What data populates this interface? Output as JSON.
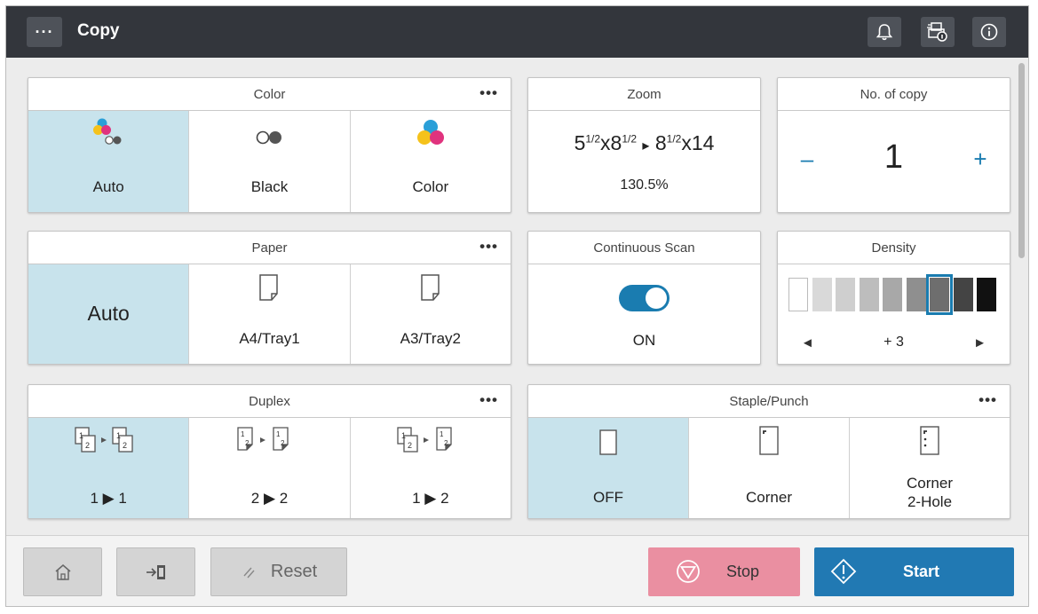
{
  "header": {
    "menu_label": "···",
    "title": "Copy",
    "icons": [
      "bell-icon",
      "job-status-icon",
      "info-icon"
    ]
  },
  "more_label": "•••",
  "color_panel": {
    "title": "Color",
    "options": [
      "Auto",
      "Black",
      "Color"
    ],
    "selected": "Auto"
  },
  "zoom_panel": {
    "title": "Zoom",
    "ratio_from_whole": "5",
    "ratio_from_frac": "1/2",
    "ratio_mid": "x8",
    "ratio_mid_frac": "1/2",
    "ratio_arrow": "▸",
    "ratio_to_whole": "8",
    "ratio_to_frac": "1/2",
    "ratio_to_rest": "x14",
    "percent": "130.5%"
  },
  "copies_panel": {
    "title": "No. of copy",
    "minus": "–",
    "value": "1",
    "plus": "+"
  },
  "paper_panel": {
    "title": "Paper",
    "options": [
      "Auto",
      "A4/Tray1",
      "A3/Tray2"
    ],
    "selected": "Auto"
  },
  "scan_panel": {
    "title": "Continuous Scan",
    "state": "ON"
  },
  "density_panel": {
    "title": "Density",
    "left_arrow": "◄",
    "value": "+ 3",
    "right_arrow": "►",
    "levels": 9,
    "selected_index": 6
  },
  "duplex_panel": {
    "title": "Duplex",
    "options": [
      "1 ▶ 1",
      "2 ▶ 2",
      "1 ▶ 2"
    ],
    "selected": "1 ▶ 1"
  },
  "staple_panel": {
    "title": "Staple/Punch",
    "options": [
      "OFF",
      "Corner",
      "Corner",
      "2-Hole"
    ],
    "selected": "OFF"
  },
  "bottom": {
    "reset_label": "Reset",
    "stop_label": "Stop",
    "start_label": "Start"
  },
  "colors": {
    "header_bg": "#33363c",
    "selected_bg": "#c8e3ec",
    "accent": "#1a7cb0",
    "stop": "#ea8fa1",
    "start": "#2179b3"
  }
}
